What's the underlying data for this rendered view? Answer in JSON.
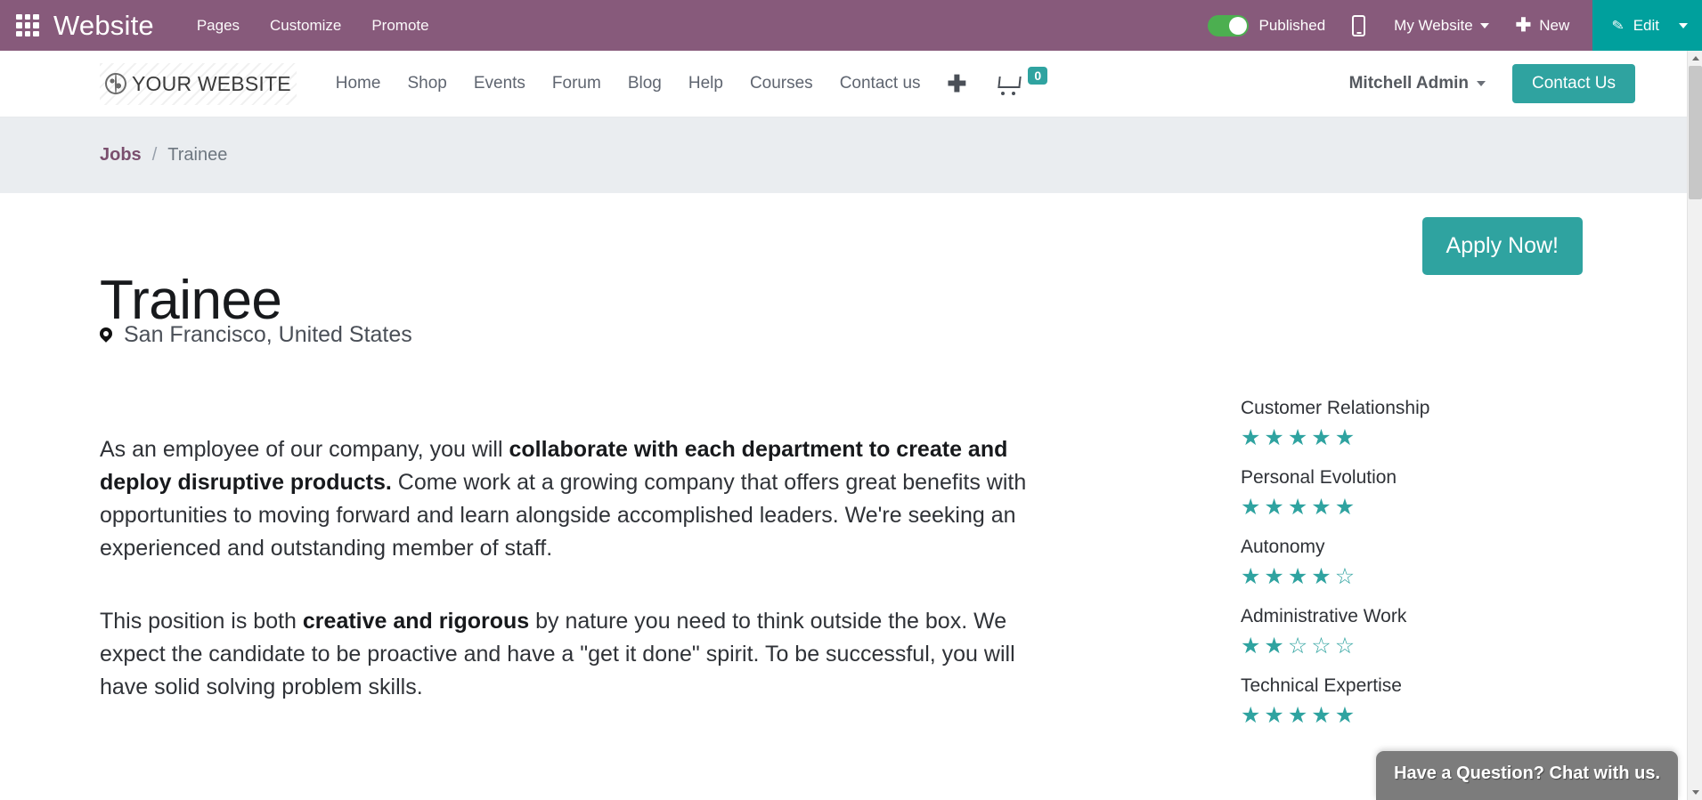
{
  "colors": {
    "odoo_purple": "#875A7B",
    "teal": "#2fa3a0",
    "edit_teal": "#00A09D",
    "toggle_green": "#4CAF50",
    "breadcrumb_bg": "#eaedf0",
    "chat_gray": "#7c7c7c"
  },
  "odoo_bar": {
    "apps_icon": "apps-grid-icon",
    "brand": "Website",
    "menus": [
      "Pages",
      "Customize",
      "Promote"
    ],
    "published_label": "Published",
    "published_state": "on",
    "mobile_icon": "mobile-preview-icon",
    "my_website": "My Website",
    "new_label": "New",
    "new_icon": "plus-icon",
    "edit_label": "Edit",
    "edit_icon": "pencil-icon"
  },
  "site_header": {
    "logo_icon": "globe-icon",
    "logo_text": "YOUR WEBSITE",
    "nav": [
      "Home",
      "Shop",
      "Events",
      "Forum",
      "Blog",
      "Help",
      "Courses",
      "Contact us"
    ],
    "add_page_icon": "plus-icon",
    "cart_icon": "shopping-cart-icon",
    "cart_count": "0",
    "user_name": "Mitchell Admin",
    "contact_button": "Contact Us"
  },
  "breadcrumb": {
    "parent": "Jobs",
    "separator": "/",
    "current": "Trainee"
  },
  "job": {
    "title": "Trainee",
    "location_icon": "map-pin-icon",
    "location": "San Francisco, United States",
    "apply_button": "Apply Now!",
    "paragraph1_pre": "As an employee of our company, you will ",
    "paragraph1_bold": "collaborate with each department to create and deploy disruptive products.",
    "paragraph1_post": " Come work at a growing company that offers great benefits with opportunities to moving forward and learn alongside accomplished leaders. We're seeking an experienced and outstanding member of staff.",
    "paragraph2_pre": "This position is both ",
    "paragraph2_bold": "creative and rigorous",
    "paragraph2_post": " by nature you need to think outside the box. We expect the candidate to be proactive and have a \"get it done\" spirit. To be successful, you will have solid solving problem skills."
  },
  "ratings": [
    {
      "label": "Customer Relationship",
      "value": 5,
      "max": 5
    },
    {
      "label": "Personal Evolution",
      "value": 5,
      "max": 5
    },
    {
      "label": "Autonomy",
      "value": 4,
      "max": 5
    },
    {
      "label": "Administrative Work",
      "value": 2,
      "max": 5
    },
    {
      "label": "Technical Expertise",
      "value": 5,
      "max": 5
    }
  ],
  "chat": {
    "label": "Have a Question? Chat with us."
  },
  "scrollbar": {
    "up_icon": "chevron-up-icon",
    "down_icon": "chevron-down-icon"
  }
}
